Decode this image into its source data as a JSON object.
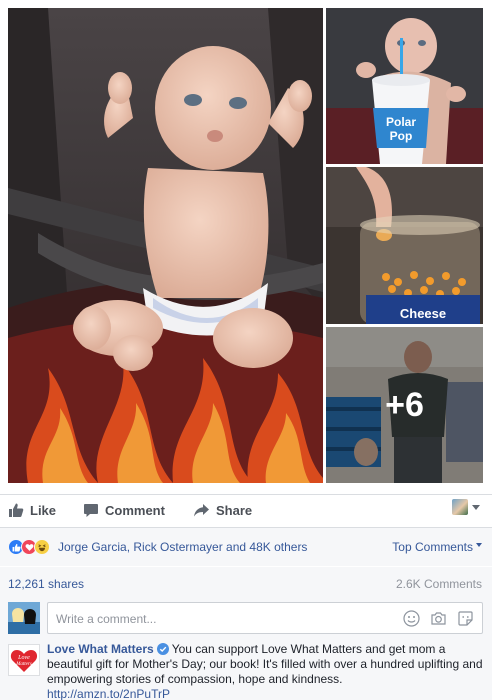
{
  "photos": {
    "more_count": "+6",
    "cup_brand_line1": "Polar",
    "cup_brand_line2": "Pop",
    "jar_label": "Cheese"
  },
  "actions": {
    "like": "Like",
    "comment": "Comment",
    "share": "Share"
  },
  "reactions": {
    "names": "Jorge Garcia, Rick Ostermayer and 48K others",
    "sort": "Top Comments"
  },
  "stats": {
    "shares": "12,261 shares",
    "comments": "2.6K Comments"
  },
  "composer": {
    "placeholder": "Write a comment..."
  },
  "post_comment": {
    "author": "Love What Matters",
    "text": "You can support Love What Matters and get mom a beautiful gift for Mother's Day; our book! It's filled with over a hundred uplifting and empowering stories of compassion, hope and kindness.",
    "link": "http://amzn.to/2nPuTrP",
    "avatar_logo": "Love What Matters"
  },
  "colors": {
    "link_blue": "#365899",
    "like_blue": "#2c7cf6",
    "love_red": "#f0465a",
    "haha_yellow": "#f7cf45",
    "panel_bg": "#f6f7f9"
  },
  "icons": [
    "thumbs-up-icon",
    "comment-bubble-icon",
    "share-arrow-icon",
    "chevron-down-icon",
    "like-reaction-icon",
    "love-reaction-icon",
    "haha-reaction-icon",
    "verified-badge-icon",
    "emoji-icon",
    "camera-icon",
    "sticker-icon"
  ]
}
